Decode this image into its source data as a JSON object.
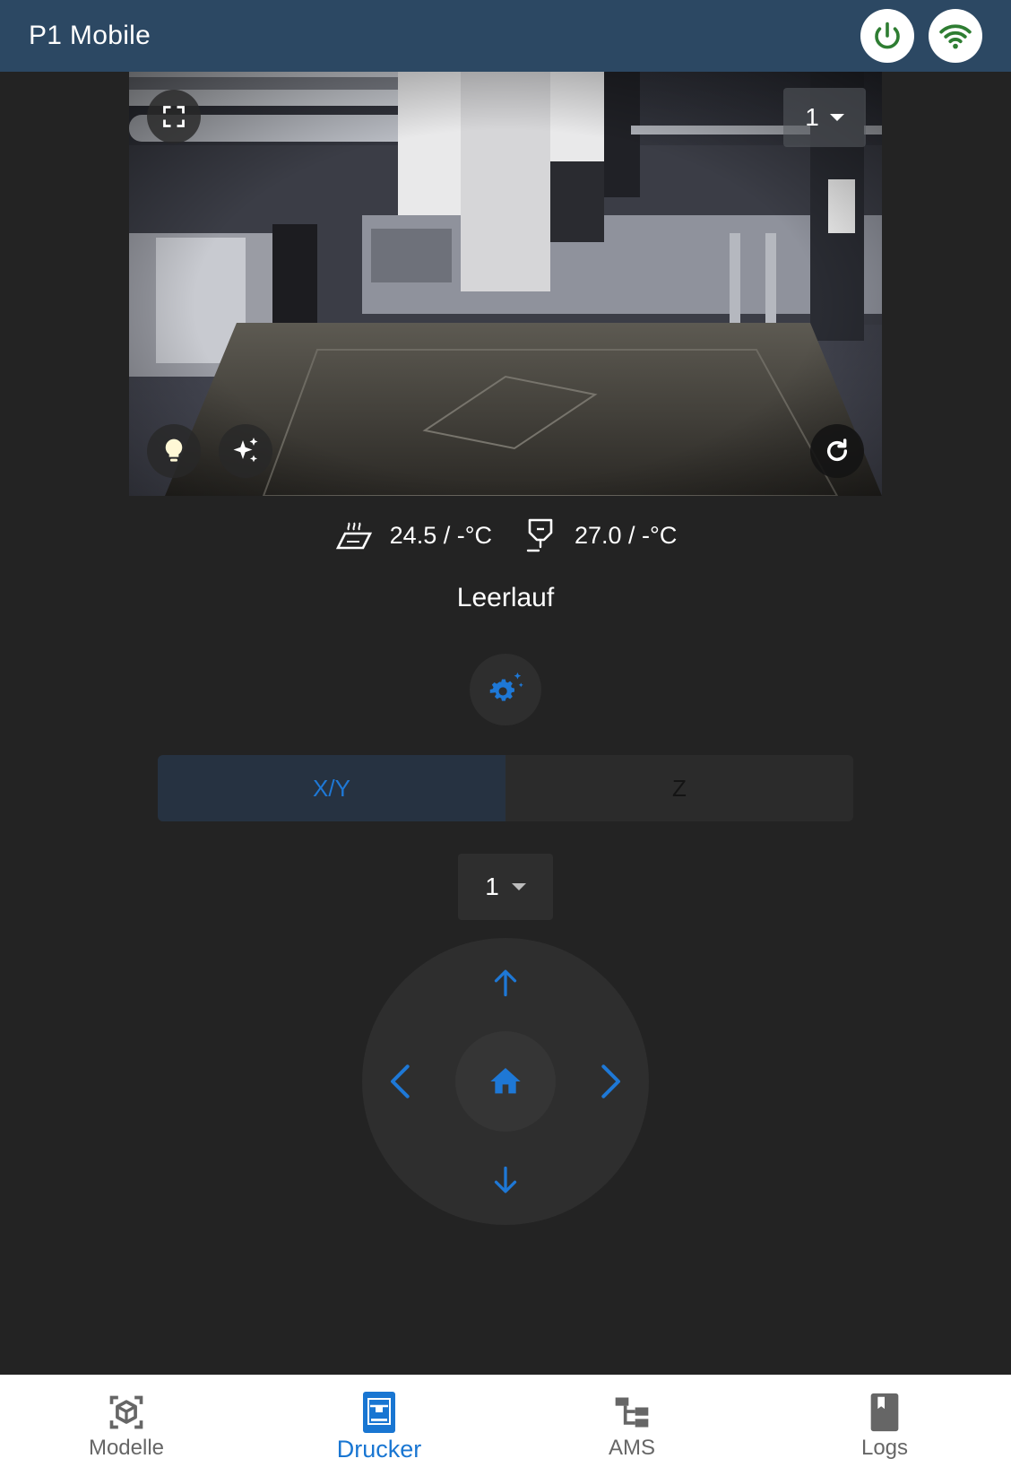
{
  "app": {
    "title": "P1 Mobile"
  },
  "header": {
    "power_icon": "power-icon",
    "wifi_icon": "wifi-icon",
    "status_color": "#2e7d32"
  },
  "camera": {
    "select_value": "1",
    "fullscreen_icon": "fullscreen-icon",
    "light_icon": "lightbulb-icon",
    "ai_icon": "sparkle-icon",
    "refresh_icon": "refresh-icon"
  },
  "temps": {
    "bed": "24.5 / -°C",
    "nozzle": "27.0 / -°C"
  },
  "status": {
    "label": "Leerlauf"
  },
  "tabs": [
    {
      "label": "X/Y",
      "active": true
    },
    {
      "label": "Z",
      "active": false
    }
  ],
  "step": {
    "value": "1"
  },
  "nav": [
    {
      "label": "Modelle",
      "icon": "cube-icon",
      "active": false
    },
    {
      "label": "Drucker",
      "icon": "printer-icon",
      "active": true
    },
    {
      "label": "AMS",
      "icon": "hierarchy-icon",
      "active": false
    },
    {
      "label": "Logs",
      "icon": "book-icon",
      "active": false
    }
  ],
  "colors": {
    "accent": "#1e78d6",
    "appbar": "#2c4863",
    "background": "#232323"
  }
}
